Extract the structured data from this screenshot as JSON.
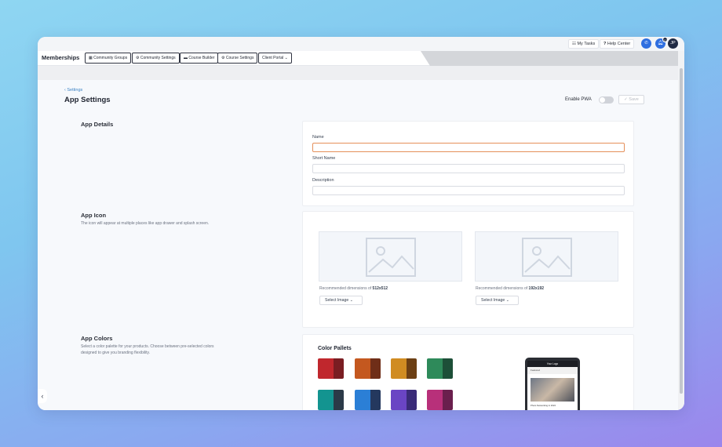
{
  "topbar": {
    "my_tasks": "My Tasks",
    "help_center": "Help Center",
    "notification_count": "17",
    "avatar_initials": "JP"
  },
  "nav": {
    "title": "Memberships",
    "buttons": [
      "Community Groups",
      "Community Settings",
      "Course Builder",
      "Course Settings",
      "Client Portal"
    ]
  },
  "page": {
    "back_label": "Settings",
    "title": "App Settings",
    "pwa_label": "Enable PWA",
    "pwa_enabled": false,
    "save_label": "Save"
  },
  "details": {
    "title": "App Details",
    "fields": [
      {
        "label": "Name",
        "value": ""
      },
      {
        "label": "Short Name",
        "value": ""
      },
      {
        "label": "Description",
        "value": ""
      }
    ]
  },
  "icon": {
    "title": "App Icon",
    "desc": "The icon will appear at multiple places like app drawer and splash screen.",
    "rec_prefix": "Recommended dimensions of",
    "slots": [
      {
        "size": "512x512",
        "button": "Select Image"
      },
      {
        "size": "192x192",
        "button": "Select Image"
      }
    ]
  },
  "colors": {
    "title": "App Colors",
    "desc": "Select a color palette for your products. Choose between pre-selected colors designed to give you branding flexibility.",
    "pallet_title": "Color Pallets",
    "swatches": [
      [
        "#c0272d",
        "#7a1d22"
      ],
      [
        "#c4581f",
        "#6f2e18"
      ],
      [
        "#d08c22",
        "#6c3f14"
      ],
      [
        "#2e8a5a",
        "#1d4f38"
      ],
      [
        "#139490",
        "#2b3a48"
      ],
      [
        "#2b7fd6",
        "#24385e"
      ],
      [
        "#6a45c4",
        "#3a2b78"
      ],
      [
        "#b8307a",
        "#6a1f4d"
      ]
    ],
    "preview": {
      "logo": "Your Logo",
      "section": "Featured",
      "caption": "Photo Networking in 2022"
    }
  }
}
